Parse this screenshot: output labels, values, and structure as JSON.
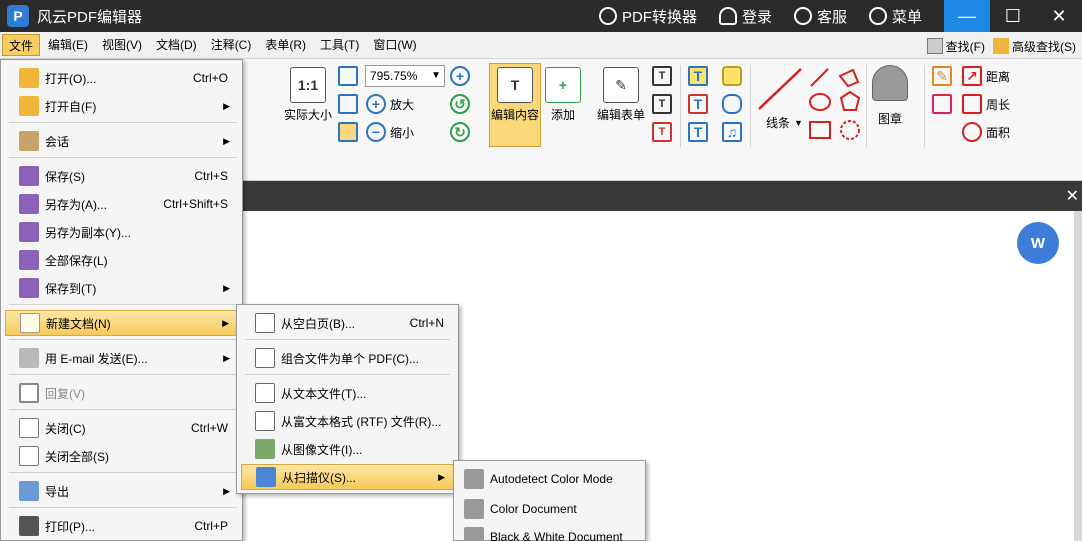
{
  "titlebar": {
    "app_title": "风云PDF编辑器",
    "converter_label": "PDF转换器",
    "login_label": "登录",
    "service_label": "客服",
    "menu_label": "菜单"
  },
  "menubar": {
    "items": [
      "文件",
      "编辑(E)",
      "视图(V)",
      "文档(D)",
      "注释(C)",
      "表单(R)",
      "工具(T)",
      "窗口(W)"
    ],
    "find_label": "查找(F)",
    "advanced_find_label": "高级查找(S)"
  },
  "toolbar": {
    "actual_size_label": "实际大小",
    "zoom_value": "795.75%",
    "zoom_in_label": "放大",
    "zoom_out_label": "缩小",
    "edit_content_label": "编辑内容",
    "add_label": "添加",
    "edit_form_label": "编辑表单",
    "lines_label": "线条",
    "stamp_label": "图章",
    "distance_label": "距离",
    "perimeter_label": "周长",
    "area_label": "面积"
  },
  "file_menu": {
    "items": [
      {
        "label": "打开(O)...",
        "shortcut": "Ctrl+O",
        "submenu": false,
        "icon": "folder-open-icon"
      },
      {
        "label": "打开自(F)",
        "shortcut": "",
        "submenu": true,
        "icon": "folder-globe-icon"
      },
      {
        "label": "会话",
        "shortcut": "",
        "submenu": true,
        "icon": "session-icon"
      },
      {
        "label": "保存(S)",
        "shortcut": "Ctrl+S",
        "submenu": false,
        "icon": "save-icon"
      },
      {
        "label": "另存为(A)...",
        "shortcut": "Ctrl+Shift+S",
        "submenu": false,
        "icon": "save-as-icon"
      },
      {
        "label": "另存为副本(Y)...",
        "shortcut": "",
        "submenu": false,
        "icon": "save-copy-icon"
      },
      {
        "label": "全部保存(L)",
        "shortcut": "",
        "submenu": false,
        "icon": "save-all-icon"
      },
      {
        "label": "保存到(T)",
        "shortcut": "",
        "submenu": true,
        "icon": "save-to-icon"
      },
      {
        "label": "新建文档(N)",
        "shortcut": "",
        "submenu": true,
        "icon": "new-document-icon"
      },
      {
        "label": "用 E-mail 发送(E)...",
        "shortcut": "",
        "submenu": true,
        "icon": "email-icon"
      },
      {
        "label": "回复(V)",
        "shortcut": "",
        "submenu": false,
        "icon": "revert-icon"
      },
      {
        "label": "关闭(C)",
        "shortcut": "Ctrl+W",
        "submenu": false,
        "icon": "close-doc-icon"
      },
      {
        "label": "关闭全部(S)",
        "shortcut": "",
        "submenu": false,
        "icon": "close-all-icon"
      },
      {
        "label": "导出",
        "shortcut": "",
        "submenu": true,
        "icon": "export-icon"
      },
      {
        "label": "打印(P)...",
        "shortcut": "Ctrl+P",
        "submenu": false,
        "icon": "print-icon"
      }
    ]
  },
  "new_menu": {
    "items": [
      {
        "label": "从空白页(B)...",
        "shortcut": "Ctrl+N",
        "submenu": false,
        "icon": "blank-page-icon"
      },
      {
        "label": "组合文件为单个 PDF(C)...",
        "shortcut": "",
        "submenu": false,
        "icon": "combine-files-icon"
      },
      {
        "label": "从文本文件(T)...",
        "shortcut": "",
        "submenu": false,
        "icon": "text-file-icon"
      },
      {
        "label": "从富文本格式 (RTF) 文件(R)...",
        "shortcut": "",
        "submenu": false,
        "icon": "rtf-file-icon"
      },
      {
        "label": "从图像文件(I)...",
        "shortcut": "",
        "submenu": false,
        "icon": "image-file-icon"
      },
      {
        "label": "从扫描仪(S)...",
        "shortcut": "",
        "submenu": true,
        "icon": "scanner-icon"
      }
    ]
  },
  "scan_menu": {
    "items": [
      {
        "label": "Autodetect Color Mode",
        "icon": "gears-icon"
      },
      {
        "label": "Color Document",
        "icon": "gears-icon"
      },
      {
        "label": "Black & White Document",
        "icon": "gears-icon"
      }
    ]
  },
  "colors": {
    "titlebar_bg": "#2b2b2b",
    "accent_blue": "#1e88e5",
    "highlight": "#f6c95a"
  }
}
